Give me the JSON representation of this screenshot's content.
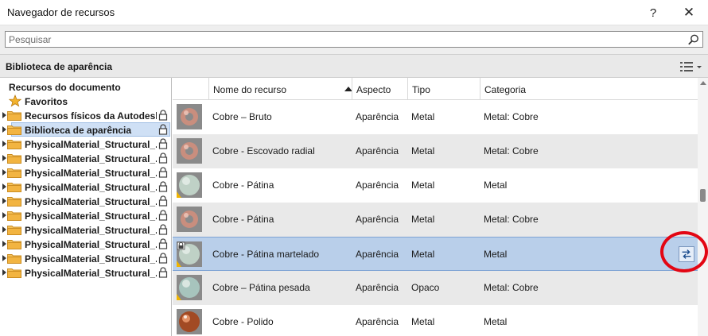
{
  "window": {
    "title": "Navegador de recursos",
    "help_label": "?",
    "close_label": "✕"
  },
  "search": {
    "placeholder": "Pesquisar"
  },
  "library_bar": {
    "title": "Biblioteca de aparência"
  },
  "tree": {
    "document_resources": "Recursos do documento",
    "favorites": "Favoritos",
    "items": [
      {
        "label": "Recursos físicos da Autodesk",
        "locked": true,
        "selected": false
      },
      {
        "label": "Biblioteca de aparência",
        "locked": true,
        "selected": true
      },
      {
        "label": "PhysicalMaterial_Structural_...",
        "locked": true,
        "selected": false
      },
      {
        "label": "PhysicalMaterial_Structural_...",
        "locked": true,
        "selected": false
      },
      {
        "label": "PhysicalMaterial_Structural_...",
        "locked": true,
        "selected": false
      },
      {
        "label": "PhysicalMaterial_Structural_...",
        "locked": true,
        "selected": false
      },
      {
        "label": "PhysicalMaterial_Structural_...",
        "locked": true,
        "selected": false
      },
      {
        "label": "PhysicalMaterial_Structural_...",
        "locked": true,
        "selected": false
      },
      {
        "label": "PhysicalMaterial_Structural_...",
        "locked": true,
        "selected": false
      },
      {
        "label": "PhysicalMaterial_Structural_...",
        "locked": true,
        "selected": false
      },
      {
        "label": "PhysicalMaterial_Structural_...",
        "locked": true,
        "selected": false
      },
      {
        "label": "PhysicalMaterial_Structural_...",
        "locked": true,
        "selected": false
      }
    ]
  },
  "grid": {
    "columns": [
      "Nome do recurso",
      "Aspecto",
      "Tipo",
      "Categoria"
    ],
    "rows": [
      {
        "name": "Cobre – Bruto",
        "aspect": "Aparência",
        "type": "Metal",
        "category": "Metal: Cobre",
        "thumb": "copper-ring"
      },
      {
        "name": "Cobre - Escovado radial",
        "aspect": "Aparência",
        "type": "Metal",
        "category": "Metal: Cobre",
        "thumb": "copper-ring"
      },
      {
        "name": "Cobre - Pátina",
        "aspect": "Aparência",
        "type": "Metal",
        "category": "Metal",
        "thumb": "patina-sphere"
      },
      {
        "name": "Cobre - Pátina",
        "aspect": "Aparência",
        "type": "Metal",
        "category": "Metal: Cobre",
        "thumb": "copper-ring"
      },
      {
        "name": "Cobre - Pátina martelado",
        "aspect": "Aparência",
        "type": "Metal",
        "category": "Metal",
        "thumb": "patina-sphere-locked",
        "selected": true
      },
      {
        "name": "Cobre – Pátina pesada",
        "aspect": "Aparência",
        "type": "Opaco",
        "category": "Metal: Cobre",
        "thumb": "patina-heavy-sphere"
      },
      {
        "name": "Cobre - Polido",
        "aspect": "Aparência",
        "type": "Metal",
        "category": "Metal",
        "thumb": "polished-sphere"
      }
    ]
  },
  "colors": {
    "selection": "#b9cfea",
    "highlight_circle": "#e30613",
    "folder": "#f2b441"
  }
}
